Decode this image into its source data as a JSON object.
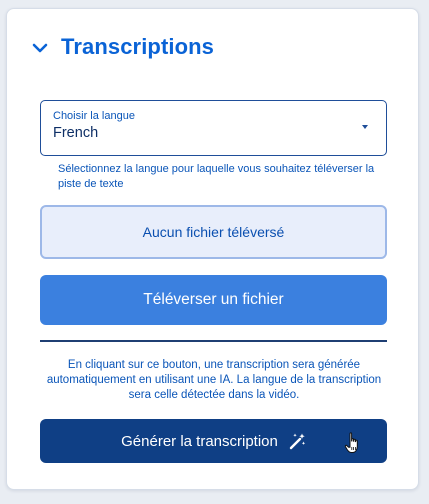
{
  "section": {
    "title": "Transcriptions",
    "icon": "chevron-down-icon"
  },
  "language_select": {
    "label": "Choisir la langue",
    "value": "French",
    "helper": "Sélectionnez la langue pour laquelle vous souhaitez téléverser la piste de texte"
  },
  "file_status": {
    "text": "Aucun fichier téléversé"
  },
  "upload_button": {
    "label": "Téléverser un fichier"
  },
  "generate_info": {
    "text": "En cliquant sur ce bouton, une transcription sera générée automatiquement en utilisant une IA. La langue de la transcription sera celle détectée dans la vidéo."
  },
  "generate_button": {
    "label": "Générer la transcription",
    "icon": "magic-wand-icon"
  },
  "colors": {
    "accent": "#0a63d6",
    "primary_button": "#3b80df",
    "dark_button": "#0f3f85"
  }
}
